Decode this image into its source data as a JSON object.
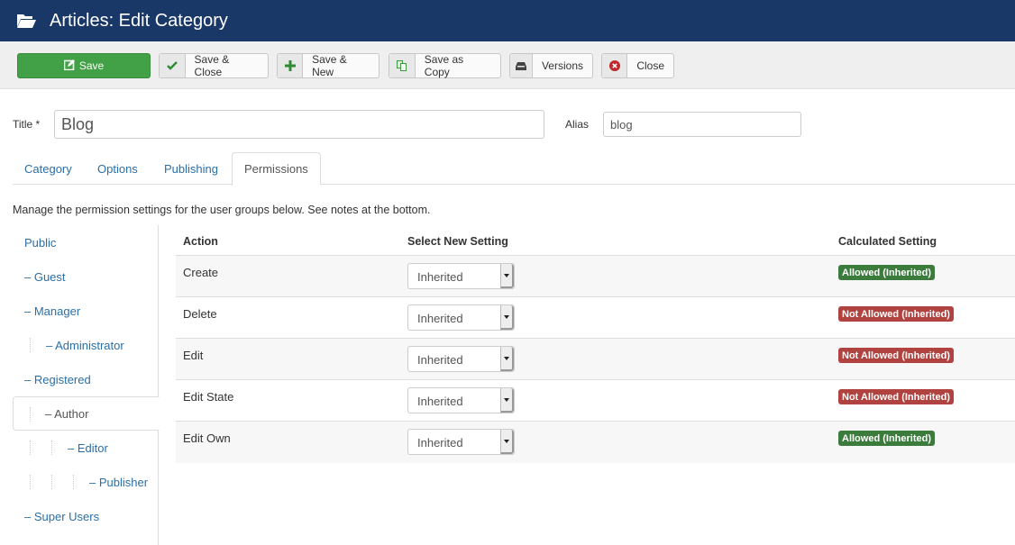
{
  "header": {
    "icon": "folder-open-icon",
    "title": "Articles: Edit Category"
  },
  "toolbar": {
    "buttons": [
      {
        "label": "Save",
        "icon": "edit-icon"
      },
      {
        "label": "Save & Close",
        "icon": "checkmark-icon"
      },
      {
        "label": "Save & New",
        "icon": "plus-icon"
      },
      {
        "label": "Save as Copy",
        "icon": "copy-icon"
      },
      {
        "label": "Versions",
        "icon": "archive-icon"
      },
      {
        "label": "Close",
        "icon": "close-circle-icon"
      }
    ]
  },
  "form": {
    "title_label": "Title *",
    "title_value": "Blog",
    "alias_label": "Alias",
    "alias_value": "blog"
  },
  "tabs": [
    {
      "label": "Category",
      "active": false
    },
    {
      "label": "Options",
      "active": false
    },
    {
      "label": "Publishing",
      "active": false
    },
    {
      "label": "Permissions",
      "active": true
    }
  ],
  "permissions": {
    "intro": "Manage the permission settings for the user groups below. See notes at the bottom.",
    "groups": [
      {
        "label": "Public",
        "level": 0
      },
      {
        "label": "– Guest",
        "level": 1
      },
      {
        "label": "– Manager",
        "level": 1
      },
      {
        "label": "– Administrator",
        "level": 2
      },
      {
        "label": "– Registered",
        "level": 1
      },
      {
        "label": "– Author",
        "level": 2,
        "active": true
      },
      {
        "label": "– Editor",
        "level": 3
      },
      {
        "label": "– Publisher",
        "level": 4
      },
      {
        "label": "– Super Users",
        "level": 1
      }
    ],
    "columns": [
      "Action",
      "Select New Setting",
      "Calculated Setting"
    ],
    "rows": [
      {
        "action": "Create",
        "setting": "Inherited",
        "calculated": "Allowed (Inherited)",
        "status": "allowed"
      },
      {
        "action": "Delete",
        "setting": "Inherited",
        "calculated": "Not Allowed (Inherited)",
        "status": "denied"
      },
      {
        "action": "Edit",
        "setting": "Inherited",
        "calculated": "Not Allowed (Inherited)",
        "status": "denied"
      },
      {
        "action": "Edit State",
        "setting": "Inherited",
        "calculated": "Not Allowed (Inherited)",
        "status": "denied"
      },
      {
        "action": "Edit Own",
        "setting": "Inherited",
        "calculated": "Allowed (Inherited)",
        "status": "allowed"
      }
    ]
  },
  "colors": {
    "header_bg": "#1a3867",
    "save_green": "#42a146",
    "link_blue": "#2a6fa8",
    "allowed_badge": "#3b7c3d",
    "denied_badge": "#b0433f"
  }
}
